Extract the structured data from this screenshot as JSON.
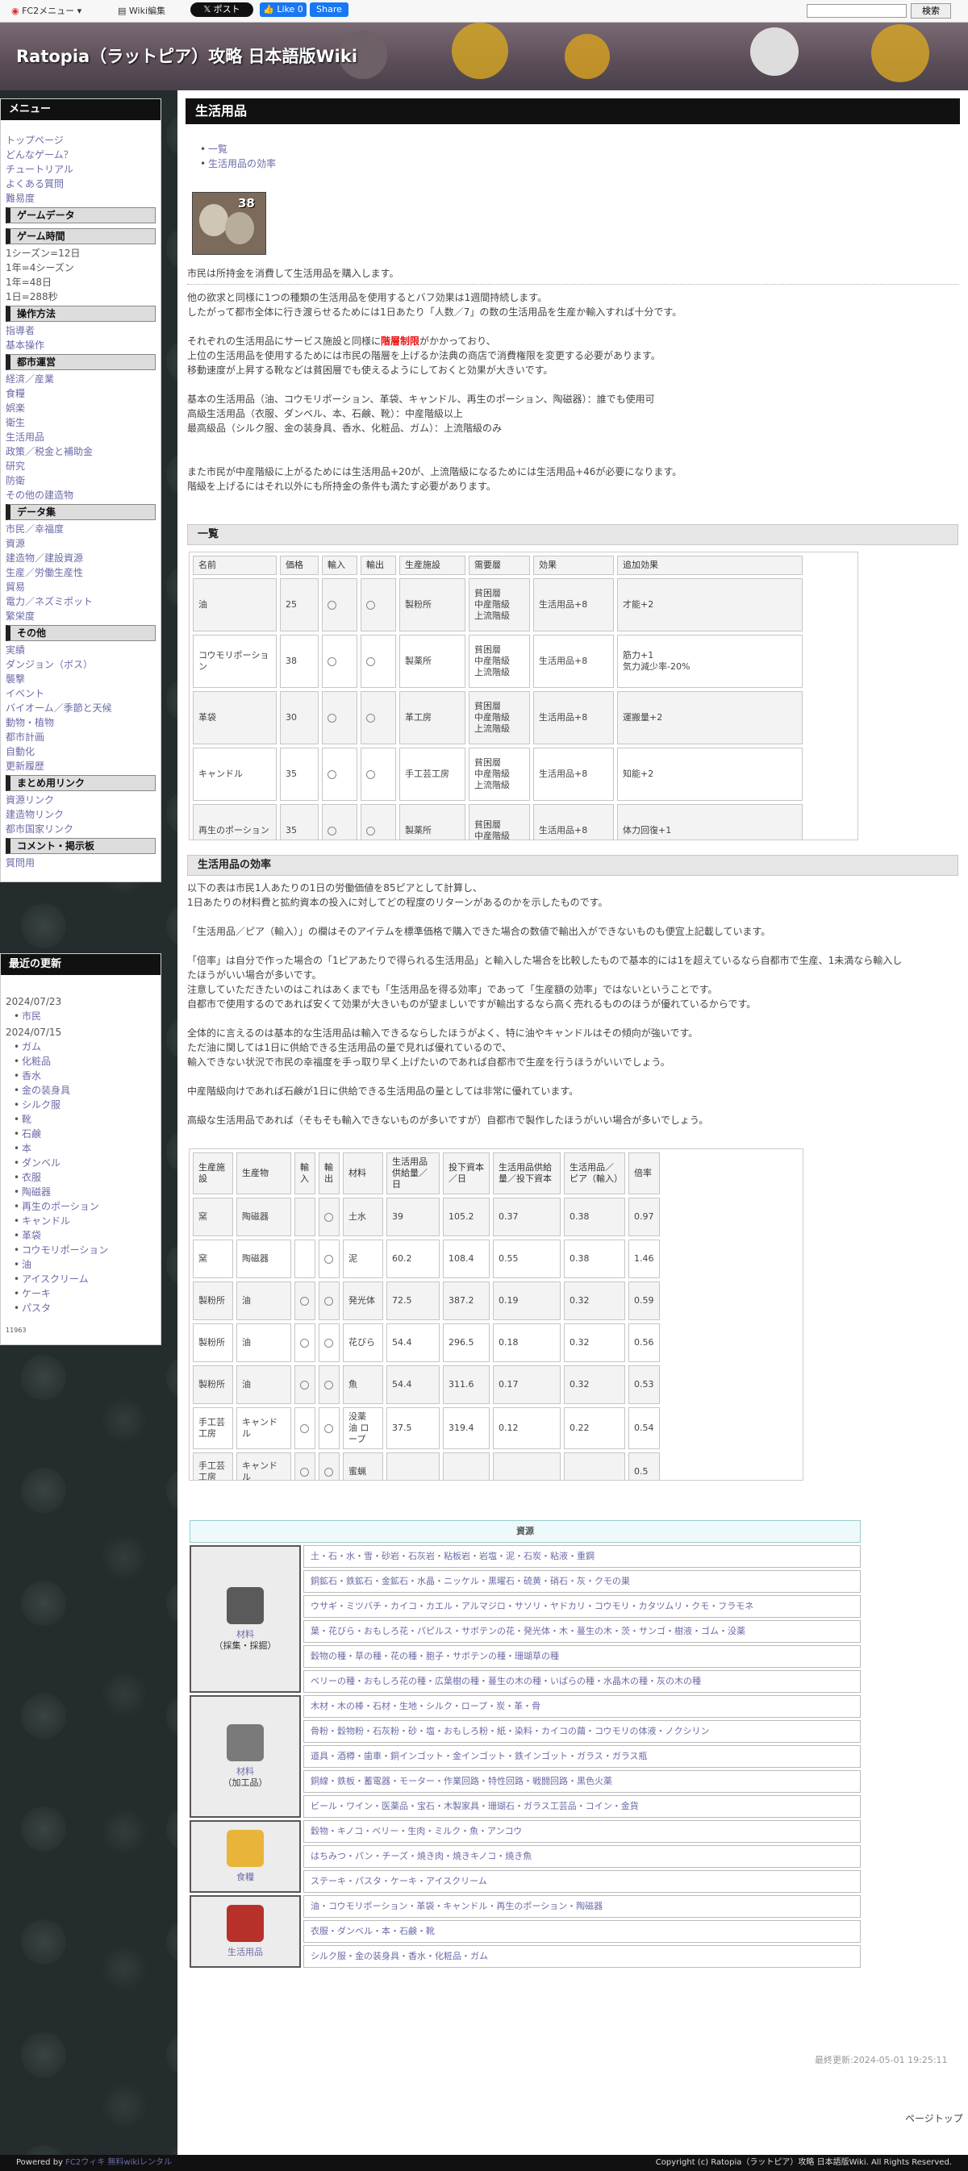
{
  "topbar": {
    "fc2menu": "FC2メニュー",
    "wikiedit": "Wiki編集",
    "xpost": "ポスト",
    "fblike": "Like 0",
    "fbshare": "Share",
    "search_button": "検索"
  },
  "site": {
    "title": "Ratopia（ラットピア）攻略 日本語版Wiki"
  },
  "sidebar": {
    "menu_title": "メニュー",
    "links_top": [
      "トップページ",
      "どんなゲーム？",
      "チュートリアル",
      "よくある質問",
      "難易度"
    ],
    "sec_gamedata": "ゲームデータ",
    "sec_gametime": "ゲーム時間",
    "gametime": [
      "1シーズン=12日",
      "1年=4シーズン",
      "1年=48日",
      "1日=288秒"
    ],
    "sec_controls": "操作方法",
    "controls": [
      "指導者",
      "基本操作"
    ],
    "sec_city": "都市運営",
    "city": [
      "経済／産業",
      "食糧",
      "娯楽",
      "衛生",
      "生活用品",
      "政策／税金と補助金",
      "研究",
      "防衛",
      "その他の建造物"
    ],
    "sec_data": "データ集",
    "data": [
      "市民／幸福度",
      "資源",
      "建造物／建設資源",
      "生産／労働生産性",
      "貿易",
      "電力／ネズミポット",
      "繁栄度"
    ],
    "sec_other": "その他",
    "other": [
      "実績",
      "ダンジョン（ボス）",
      "襲撃",
      "イベント",
      "バイオーム／季節と天候",
      "動物・植物",
      "都市計画",
      "自動化",
      "更新履歴"
    ],
    "sec_links": "まとめ用リンク",
    "links": [
      "資源リンク",
      "建造物リンク",
      "都市国家リンク"
    ],
    "sec_comment": "コメント・掲示板",
    "comment": [
      "質問用"
    ],
    "recent_title": "最近の更新",
    "recent_date1": "2024/07/23",
    "recent1": [
      "市民"
    ],
    "recent_date2": "2024/07/15",
    "recent2": [
      "ガム",
      "化粧品",
      "香水",
      "金の装身具",
      "シルク服",
      "靴",
      "石鹸",
      "本",
      "ダンベル",
      "衣服",
      "陶磁器",
      "再生のポーション",
      "キャンドル",
      "革袋",
      "コウモリポーション",
      "油",
      "アイスクリーム",
      "ケーキ",
      "パスタ"
    ],
    "counter": "11963"
  },
  "main": {
    "page_title": "生活用品",
    "toc": [
      "一覧",
      "生活用品の効率"
    ],
    "icon_number": "38",
    "intro": "市民は所持金を消費して生活用品を購入します。",
    "p1": [
      "他の欲求と同様に1つの種類の生活用品を使用するとバフ効果は1週間持続します。",
      "したがって都市全体に行き渡らせるためには1日あたり「人数／7」の数の生活用品を生産か輸入すれば十分です。"
    ],
    "p2a": "それぞれの生活用品にサービス施設と同様に",
    "p2b": "階層制限",
    "p2c": "がかかっており、",
    "p3": "上位の生活用品を使用するためには市民の階層を上げるか法典の商店で消費権限を変更する必要があります。",
    "p4": "移動速度が上昇する靴などは貧困層でも使えるようにしておくと効果が大きいです。",
    "p5": "基本の生活用品（油、コウモリポーション、革袋、キャンドル、再生のポーション、陶磁器）：誰でも使用可",
    "p6": "高級生活用品（衣服、ダンベル、本、石鹸、靴）：中産階級以上",
    "p7": "最高級品（シルク服、金の装身具、香水、化粧品、ガム）：上流階級のみ",
    "p8": "また市民が中産階級に上がるためには生活用品+20が、上流階級になるためには生活用品+46が必要になります。",
    "p9": "階級を上げるにはそれ以外にも所持金の条件も満たす必要があります。",
    "h_list": "一覧",
    "h_eff": "生活用品の効率",
    "e1": "以下の表は市民1人あたりの1日の労働価値を85ピアとして計算し、",
    "e2": "1日あたりの材料費と拡約資本の投入に対してどの程度のリターンがあるのかを示したものです。",
    "e3": "「生活用品／ピア（輸入）」の欄はそのアイテムを標準価格で購入できた場合の数値で輸出入ができないものも便宜上記載しています。",
    "e4": "「倍率」は自分で作った場合の「1ピアあたりで得られる生活用品」と輸入した場合を比較したもので基本的には1を超えているなら自都市で生産、1未満なら輸入し",
    "e4b": "たほうがいい場合が多いです。",
    "e5": "注意していただきたいのはこれはあくまでも「生活用品を得る効率」であって「生産額の効率」ではないということです。",
    "e6": "自都市で使用するのであれば安くて効果が大きいものが望ましいですが輸出するなら高く売れるもののほうが優れているからです。",
    "e7": "全体的に言えるのは基本的な生活用品は輸入できるならしたほうがよく、特に油やキャンドルはその傾向が強いです。",
    "e8": "ただ油に関しては1日に供給できる生活用品の量で見れば優れているので、",
    "e9": "輸入できない状況で市民の幸福度を手っ取り早く上げたいのであれば自都市で生産を行うほうがいいでしょう。",
    "e10": "中産階級向けであれば石鹸が1日に供給できる生活用品の量としては非常に優れています。",
    "e11": "高級な生活用品であれば（そもそも輸入できないものが多いですが）自都市で製作したほうがいい場合が多いでしょう。",
    "last_update": "最終更新:2024-05-01 19:25:11",
    "pagetop": "ページトップ"
  },
  "list_table": {
    "headers": [
      "名前",
      "価格",
      "輸入",
      "輸出",
      "生産施設",
      "需要層",
      "効果",
      "追加効果"
    ],
    "rows": [
      {
        "name": "油",
        "price": "25",
        "fac": "製粉所",
        "demand": [
          "貧困層",
          "中産階級",
          "上流階級"
        ],
        "effect": "生活用品+8",
        "extra": [
          "才能+2"
        ]
      },
      {
        "name": "コウモリポーション",
        "price": "38",
        "fac": "製薬所",
        "demand": [
          "貧困層",
          "中産階級",
          "上流階級"
        ],
        "effect": "生活用品+8",
        "extra": [
          "筋力+1",
          "気力減少率-20%"
        ]
      },
      {
        "name": "革袋",
        "price": "30",
        "fac": "革工房",
        "demand": [
          "貧困層",
          "中産階級",
          "上流階級"
        ],
        "effect": "生活用品+8",
        "extra": [
          "運搬量+2"
        ]
      },
      {
        "name": "キャンドル",
        "price": "35",
        "fac": "手工芸工房",
        "demand": [
          "貧困層",
          "中産階級",
          "上流階級"
        ],
        "effect": "生活用品+8",
        "extra": [
          "知能+2"
        ]
      },
      {
        "name": "再生のポーション",
        "price": "35",
        "fac": "製薬所",
        "demand": [
          "貧困層",
          "中産階級"
        ],
        "effect": "生活用品+8",
        "extra": [
          "体力回復+1"
        ]
      }
    ]
  },
  "eff_table": {
    "headers": [
      "生産施設",
      "生産物",
      "輸入",
      "輸出",
      "材料",
      "生活用品供給量／日",
      "投下資本／日",
      "生活用品供給量／投下資本",
      "生活用品／ピア（輸入）",
      "倍率"
    ],
    "rows": [
      {
        "fac": "窯",
        "prod": "陶磁器",
        "imp": false,
        "mat": "土水",
        "supply": "39",
        "capital": "105.2",
        "ratio": "0.37",
        "import_ratio": "0.38",
        "mult": "0.97"
      },
      {
        "fac": "窯",
        "prod": "陶磁器",
        "imp": false,
        "mat": "泥",
        "supply": "60.2",
        "capital": "108.4",
        "ratio": "0.55",
        "import_ratio": "0.38",
        "mult": "1.46"
      },
      {
        "fac": "製粉所",
        "prod": "油",
        "imp": true,
        "mat": "発光体",
        "supply": "72.5",
        "capital": "387.2",
        "ratio": "0.19",
        "import_ratio": "0.32",
        "mult": "0.59"
      },
      {
        "fac": "製粉所",
        "prod": "油",
        "imp": true,
        "mat": "花びら",
        "supply": "54.4",
        "capital": "296.5",
        "ratio": "0.18",
        "import_ratio": "0.32",
        "mult": "0.56"
      },
      {
        "fac": "製粉所",
        "prod": "油",
        "imp": true,
        "mat": "魚",
        "supply": "54.4",
        "capital": "311.6",
        "ratio": "0.17",
        "import_ratio": "0.32",
        "mult": "0.53"
      },
      {
        "fac": "手工芸工房",
        "prod": "キャンドル",
        "imp": true,
        "mat": "没薬 油 ロープ",
        "supply": "37.5",
        "capital": "319.4",
        "ratio": "0.12",
        "import_ratio": "0.22",
        "mult": "0.54"
      },
      {
        "fac": "手工芸工房",
        "prod": "キャンドル",
        "imp": true,
        "mat": "蜜蝋",
        "supply": "",
        "capital": "",
        "ratio": "",
        "import_ratio": "",
        "mult": "0.5"
      }
    ]
  },
  "resources": {
    "title": "資源",
    "groups": [
      {
        "label": "材料",
        "sub": "（採集・採掘）",
        "icon": "ore-icon",
        "color": "#5a5a5a",
        "rows": [
          "土・石・水・雪・砂岩・石灰岩・粘板岩・岩塩・泥・石炭・粘液・重鋼",
          "銅鉱石・鉄鉱石・金鉱石・水晶・ニッケル・黒曜石・硫黄・硝石・灰・クモの巣",
          "ウサギ・ミツバチ・カイコ・カエル・アルマジロ・サソリ・ヤドカリ・コウモリ・カタツムリ・クモ・フラモネ",
          "葉・花びら・おもしろ花・パピルス・サボテンの花・発光体・木・蔓生の木・茨・サンゴ・樹液・ゴム・没薬",
          "穀物の種・草の種・花の種・胞子・サボテンの種・珊瑚草の種",
          "ベリーの種・おもしろ花の種・広葉樹の種・蔓生の木の種・いばらの種・水晶木の種・灰の木の種"
        ]
      },
      {
        "label": "材料",
        "sub": "（加工品）",
        "icon": "ingot-icon",
        "color": "#7a7a7a",
        "rows": [
          "木材・木の棒・石材・生地・シルク・ロープ・炭・革・骨",
          "骨粉・穀物粉・石灰粉・砂・塩・おもしろ粉・紙・染料・カイコの繭・コウモリの体液・ノクシリン",
          "道具・酒樽・歯車・銅インゴット・金インゴット・鉄インゴット・ガラス・ガラス瓶",
          "銅線・鉄板・蓄電器・モーター・作業回路・特性回路・戦闘回路・黒色火薬",
          "ビール・ワイン・医薬品・宝石・木製家具・珊瑚石・ガラス工芸品・コイン・金貨"
        ]
      },
      {
        "label": "食糧",
        "sub": "",
        "icon": "cheese-icon",
        "color": "#e8b53a",
        "rows": [
          "穀物・キノコ・ベリー・生肉・ミルク・魚・アンコウ",
          "はちみつ・パン・チーズ・焼き肉・焼きキノコ・焼き魚",
          "ステーキ・パスタ・ケーキ・アイスクリーム"
        ]
      },
      {
        "label": "生活用品",
        "sub": "",
        "icon": "clothes-icon",
        "color": "#b8302a",
        "rows": [
          "油・コウモリポーション・革袋・キャンドル・再生のポーション・陶磁器",
          "衣服・ダンベル・本・石鹸・靴",
          "シルク服・金の装身具・香水・化粧品・ガム"
        ]
      }
    ]
  },
  "footer": {
    "powered": "Powered by",
    "fc2": "FC2ウィキ",
    "rental": "無料wikiレンタル",
    "copyright": "Copyright (c) Ratopia（ラットピア）攻略 日本語版Wiki. All Rights Reserved."
  }
}
